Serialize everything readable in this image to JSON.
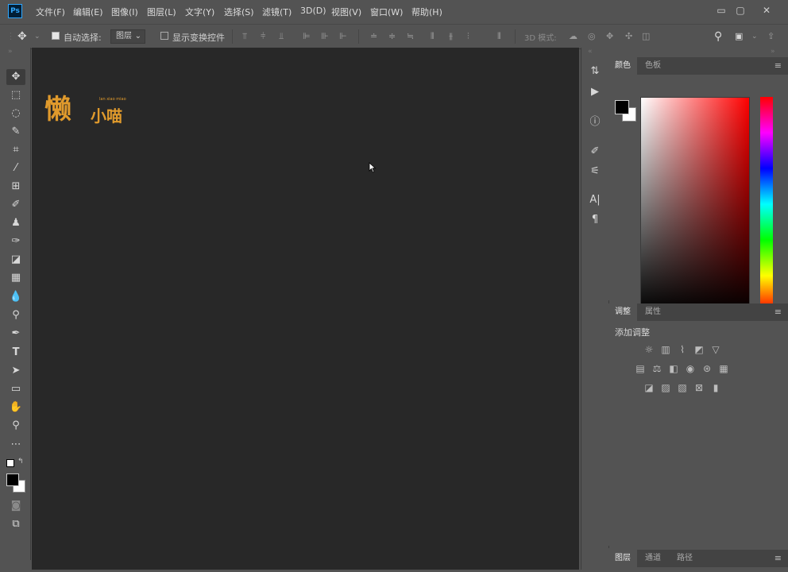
{
  "app": {
    "logo": "Ps"
  },
  "menu": [
    "文件(F)",
    "编辑(E)",
    "图像(I)",
    "图层(L)",
    "文字(Y)",
    "选择(S)",
    "滤镜(T)",
    "3D(D)",
    "视图(V)",
    "窗口(W)",
    "帮助(H)"
  ],
  "window_controls": {
    "minimize": "▭",
    "restore": "▢",
    "close": "✕"
  },
  "options": {
    "auto_select_label": "自动选择:",
    "auto_select_value": "图层",
    "show_transform_label": "显示变换控件",
    "mode_3d_label": "3D 模式:"
  },
  "canvas": {
    "logo_main": "懒",
    "logo_sub": "小喵",
    "logo_small": "lan xiao miao"
  },
  "color_panel": {
    "tabs": [
      "颜色",
      "色板"
    ],
    "fg_color": "#000000",
    "bg_color": "#ffffff"
  },
  "adjust_panel": {
    "tabs": [
      "调整",
      "属性"
    ],
    "add_label": "添加调整"
  },
  "layers_panel": {
    "tabs": [
      "图层",
      "通道",
      "路径"
    ]
  },
  "panel_menu_icon": "≡"
}
